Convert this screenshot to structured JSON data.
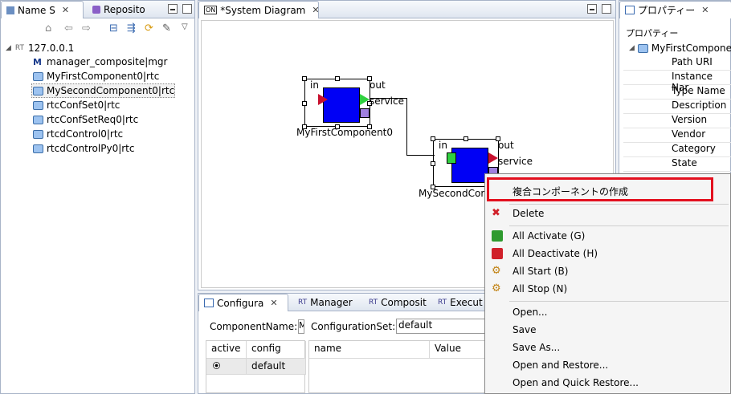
{
  "left_panel": {
    "tabs": [
      {
        "label": "Name S"
      },
      {
        "label": "Reposito"
      }
    ],
    "host": "127.0.0.1",
    "host_prefix": "RT",
    "items": [
      {
        "label": "manager_composite|mgr",
        "type": "manager"
      },
      {
        "label": "MyFirstComponent0|rtc",
        "type": "rtc"
      },
      {
        "label": "MySecondComponent0|rtc",
        "type": "rtc"
      },
      {
        "label": "rtcConfSet0|rtc",
        "type": "rtc"
      },
      {
        "label": "rtcConfSetReq0|rtc",
        "type": "rtc"
      },
      {
        "label": "rtcdControl0|rtc",
        "type": "rtc"
      },
      {
        "label": "rtcdControlPy0|rtc",
        "type": "rtc"
      }
    ]
  },
  "editor": {
    "tab_label": "*System Diagram",
    "components": [
      {
        "name": "MyFirstComponent0",
        "in_label": "in",
        "out_label": "out",
        "service_label": "service"
      },
      {
        "name": "MySecondCom",
        "in_label": "in",
        "out_label": "out",
        "service_label": "service"
      }
    ]
  },
  "bottom_panel": {
    "tabs": [
      {
        "label": "Configura"
      },
      {
        "label": "Manager"
      },
      {
        "label": "Composit"
      },
      {
        "label": "Execut"
      }
    ],
    "component_name_label": "ComponentName:",
    "component_name_value": "M",
    "config_set_label": "ConfigurationSet:",
    "config_set_value": "default",
    "left_table": {
      "headers": [
        "active",
        "config"
      ],
      "rows": [
        {
          "active": true,
          "config": "default"
        }
      ]
    },
    "right_table": {
      "headers": [
        "name",
        "Value"
      ]
    }
  },
  "properties": {
    "tab_label": "プロパティー",
    "header": "プロパティー",
    "root": "MyFirstCompone",
    "rows": [
      "Path URI",
      "Instance Nar",
      "Type Name",
      "Description",
      "Version",
      "Vendor",
      "Category",
      "State"
    ]
  },
  "context_menu": {
    "items": [
      {
        "label": "複合コンポーネントの作成",
        "icon": "none"
      },
      {
        "label": "Delete",
        "icon": "delete-icon"
      },
      {
        "label": "All Activate (G)",
        "icon": "activate-icon"
      },
      {
        "label": "All Deactivate (H)",
        "icon": "deactivate-icon"
      },
      {
        "label": "All Start (B)",
        "icon": "start-icon"
      },
      {
        "label": "All Stop (N)",
        "icon": "stop-icon"
      },
      {
        "label": "Open...",
        "icon": "none"
      },
      {
        "label": "Save",
        "icon": "none"
      },
      {
        "label": "Save As...",
        "icon": "none"
      },
      {
        "label": "Open and Restore...",
        "icon": "none"
      },
      {
        "label": "Open and Quick Restore...",
        "icon": "none"
      }
    ],
    "highlight_color": "#e3101f"
  }
}
